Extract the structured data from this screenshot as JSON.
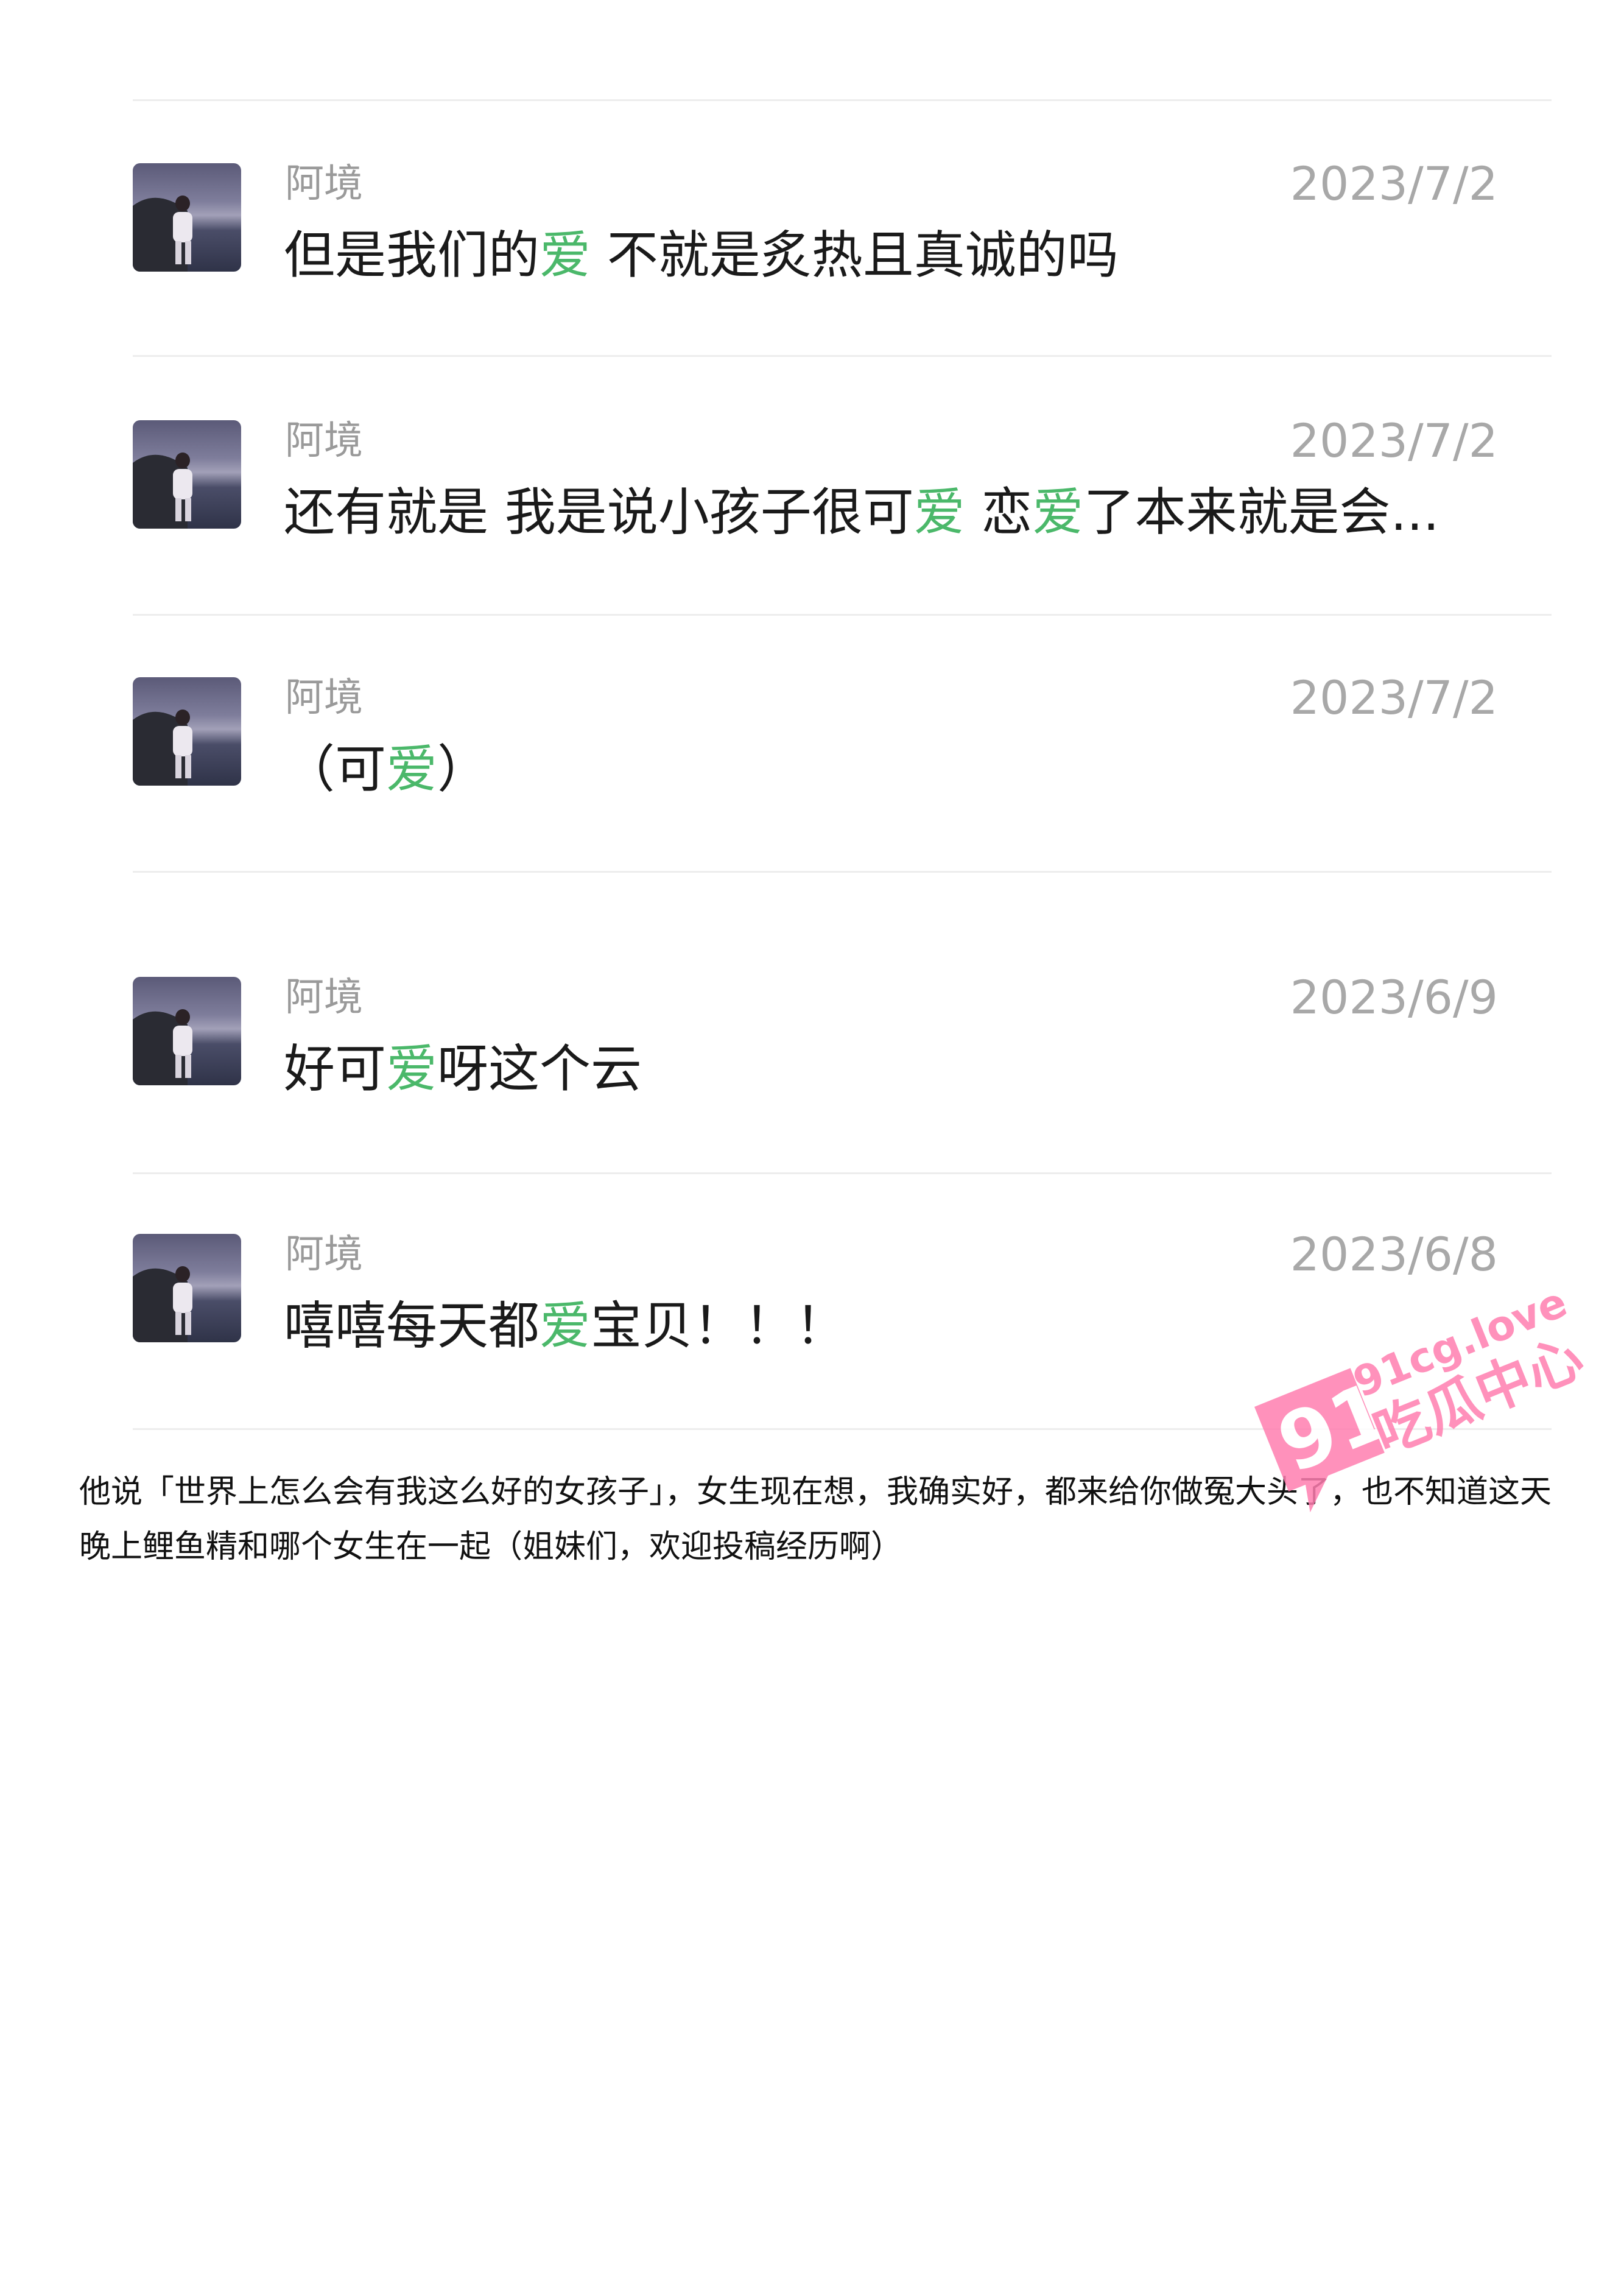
{
  "messages": [
    {
      "name": "阿境",
      "date": "2023/7/2",
      "text": "但是我们的爱 不就是炙热且真诚的吗"
    },
    {
      "name": "阿境",
      "date": "2023/7/2",
      "text": "还有就是 我是说小孩子很可爱 恋爱了本来就是会..."
    },
    {
      "name": "阿境",
      "date": "2023/7/2",
      "text": "（可爱）"
    },
    {
      "name": "阿境",
      "date": "2023/6/9",
      "text": "好可爱呀这个云"
    },
    {
      "name": "阿境",
      "date": "2023/6/8",
      "text": "嘻嘻每天都爱宝贝！！！"
    }
  ],
  "highlight_word": "爱",
  "highlight_color": "#4bb86a",
  "caption": "他说「世界上怎么会有我这么好的女孩子」，女生现在想，我确实好，都来给你做冤大头了，也不知道这天晚上鲤鱼精和哪个女生在一起（姐妹们，欢迎投稿经历啊）",
  "watermark": {
    "site": "91cg.love",
    "name": "吃瓜中心",
    "badge": "91",
    "color": "#ff7eb0"
  }
}
